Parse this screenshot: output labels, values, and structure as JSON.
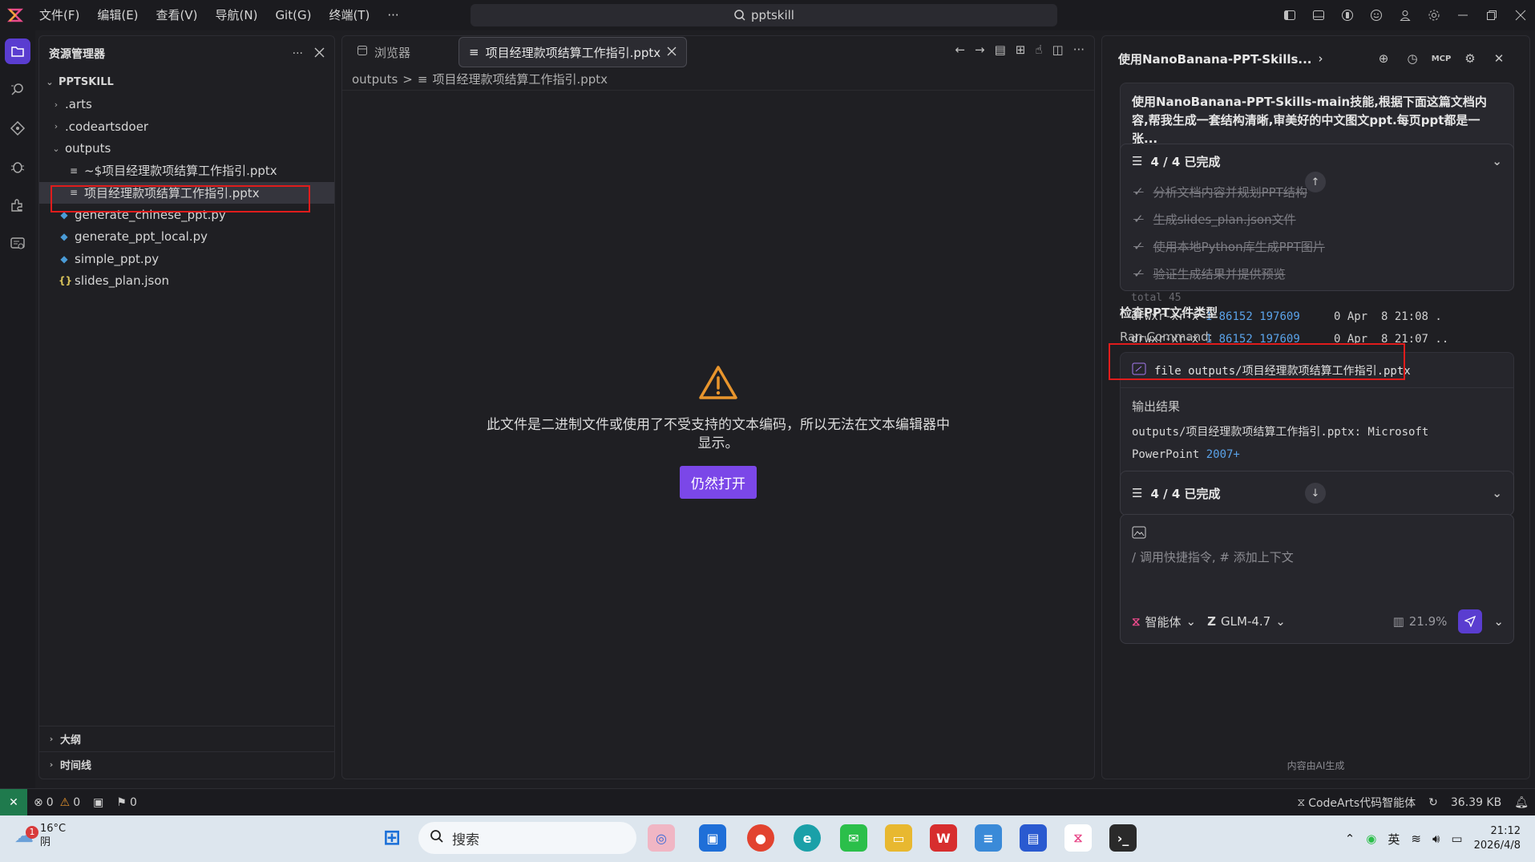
{
  "menu": {
    "items": [
      "文件(F)",
      "编辑(E)",
      "查看(V)",
      "导航(N)",
      "Git(G)",
      "终端(T)"
    ],
    "more": "···",
    "search_text": "pptskill"
  },
  "explorer": {
    "title": "资源管理器",
    "more": "···",
    "root": "PPTSKILL",
    "items": [
      {
        "label": ".arts"
      },
      {
        "label": ".codeartsdoer"
      },
      {
        "label": "outputs"
      },
      {
        "label": "~$项目经理款项结算工作指引.pptx"
      },
      {
        "label": "项目经理款项结算工作指引.pptx"
      },
      {
        "label": "generate_chinese_ppt.py"
      },
      {
        "label": "generate_ppt_local.py"
      },
      {
        "label": "simple_ppt.py"
      },
      {
        "label": "slides_plan.json"
      }
    ],
    "outline": "大纲",
    "timeline": "时间线"
  },
  "editor": {
    "tabs": [
      {
        "label": "浏览器"
      },
      {
        "label": "项目经理款项结算工作指引.pptx"
      }
    ],
    "breadcrumb": {
      "folder": "outputs",
      "sep": ">",
      "file": "项目经理款项结算工作指引.pptx"
    },
    "message": "此文件是二进制文件或使用了不受支持的文本编码，所以无法在文本编辑器中显示。",
    "open_anyway": "仍然打开"
  },
  "ai": {
    "title": "使用NanoBanana-PPT-Skills...",
    "user_message": "使用NanoBanana-PPT-Skills-main技能,根据下面这篇文档内容,帮我生成一套结构清晰,审美好的中文图文ppt.每页ppt都是一张...",
    "todo_status": "4 / 4 已完成",
    "todos": [
      "分析文档内容并规划PPT结构",
      "生成slides_plan.json文件",
      "使用本地Python库生成PPT图片",
      "验证生成结果并提供预览"
    ],
    "terminal": {
      "total": "total 45",
      "lines": [
        {
          "perm": "drwxr-xr-x",
          "n1": "1",
          "n2": "86152",
          "n3": "197609",
          "size": "0",
          "date": "Apr  8 21:08",
          "name": "."
        },
        {
          "perm": "drwxr-xr-x",
          "n1": "1",
          "n2": "86152",
          "n3": "197609",
          "size": "0",
          "date": "Apr  8 21:07",
          "name": ".."
        }
      ]
    },
    "section_title": "检查PPT文件类型",
    "ran_command_label": "Ran Command:",
    "command": "file outputs/项目经理款项结算工作指引.pptx",
    "output_label": "输出结果",
    "output_line1": "outputs/项目经理款项结算工作指引.pptx: Microsoft",
    "output_line2a": "PowerPoint ",
    "output_line2b": "2007+",
    "todo_status2": "4 / 4 已完成",
    "input_placeholder": "/ 调用快捷指令, # 添加上下文",
    "agent_label": "智能体",
    "model_label": "GLM-4.7",
    "context_percent": "21.9%",
    "footer": "内容由AI生成"
  },
  "status": {
    "errors": "0",
    "warnings": "0",
    "ports": "0",
    "agent": "CodeArts代码智能体",
    "size": "36.39 KB"
  },
  "taskbar": {
    "temperature": "16°C",
    "weather": "阴",
    "badge": "1",
    "search": "搜索",
    "lang": "英",
    "time": "21:12",
    "date": "2026/4/8"
  },
  "colors": {
    "accent": "#7b47e8",
    "highlight": "#e01c1c",
    "number": "#5aa2e8"
  }
}
